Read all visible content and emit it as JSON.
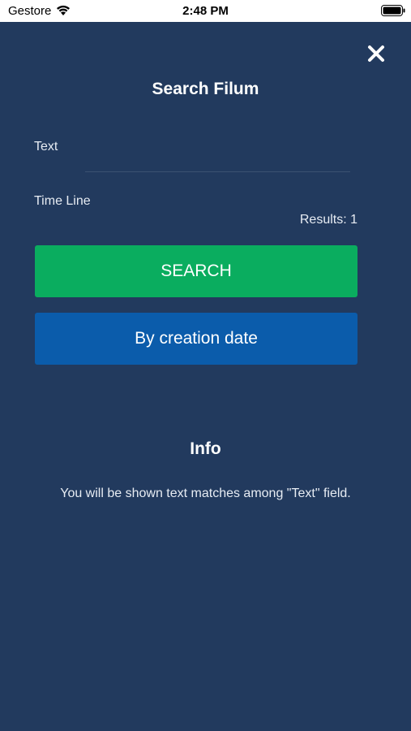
{
  "status_bar": {
    "carrier": "Gestore",
    "time": "2:48 PM",
    "wifi_icon": "wifi-icon",
    "battery_icon": "battery-icon"
  },
  "header": {
    "close_icon": "close-icon",
    "title": "Search Filum"
  },
  "form": {
    "text_label": "Text",
    "text_value": "",
    "timeline_label": "Time Line",
    "results_text": "Results: 1"
  },
  "buttons": {
    "search_label": "SEARCH",
    "date_label": "By creation date"
  },
  "info": {
    "title": "Info",
    "text": "You will be shown text matches among \"Text\" field."
  },
  "colors": {
    "background": "#223a5e",
    "search_button": "#0aad5f",
    "date_button": "#0b5cab"
  }
}
